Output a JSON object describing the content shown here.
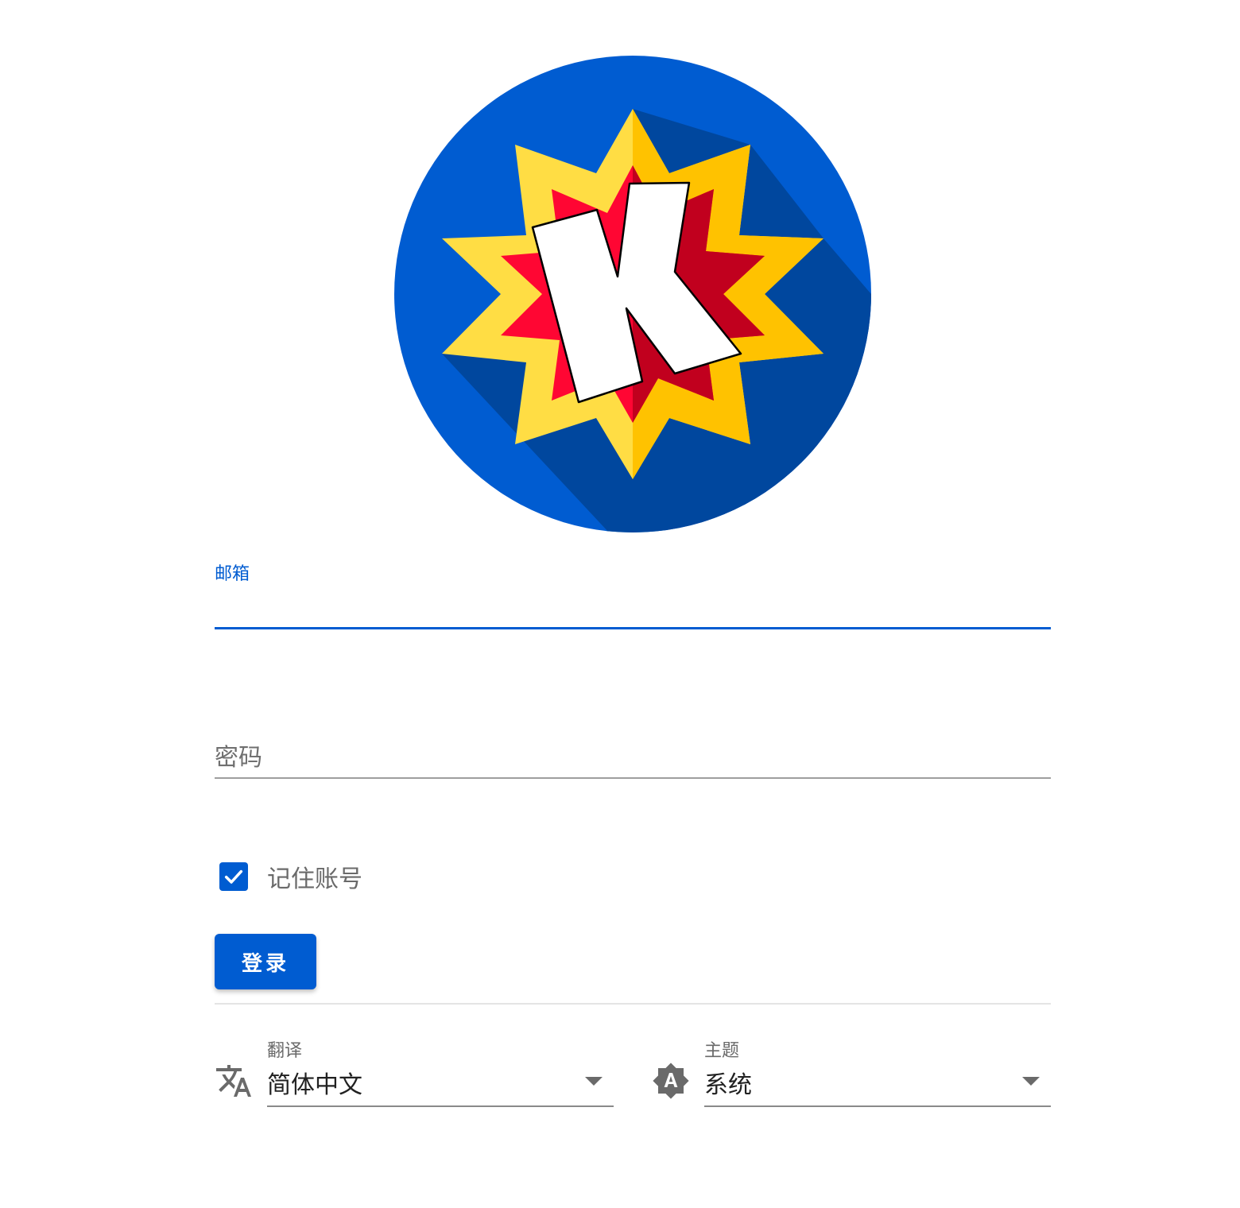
{
  "logo": {
    "icon": "k-starburst-logo-icon",
    "colors": {
      "circle": "#005cd1",
      "shadow": "#00479e",
      "star_outer_light": "#ffdd44",
      "star_outer_dark": "#ffc200",
      "star_inner_light": "#ff0633",
      "star_inner_dark": "#c1001e",
      "letter": "#ffffff"
    }
  },
  "form": {
    "email": {
      "label": "邮箱",
      "value": "",
      "focused": true
    },
    "password": {
      "label": "密码",
      "value": ""
    },
    "remember": {
      "label": "记住账号",
      "checked": true
    },
    "login_button": "登录"
  },
  "settings": {
    "language": {
      "icon": "translate-icon",
      "label": "翻译",
      "value": "简体中文"
    },
    "theme": {
      "icon": "brightness-auto-icon",
      "label": "主题",
      "value": "系统"
    }
  },
  "colors": {
    "accent": "#005cd1",
    "muted_text": "#6a6a6a",
    "divider": "#e4e4e4"
  }
}
